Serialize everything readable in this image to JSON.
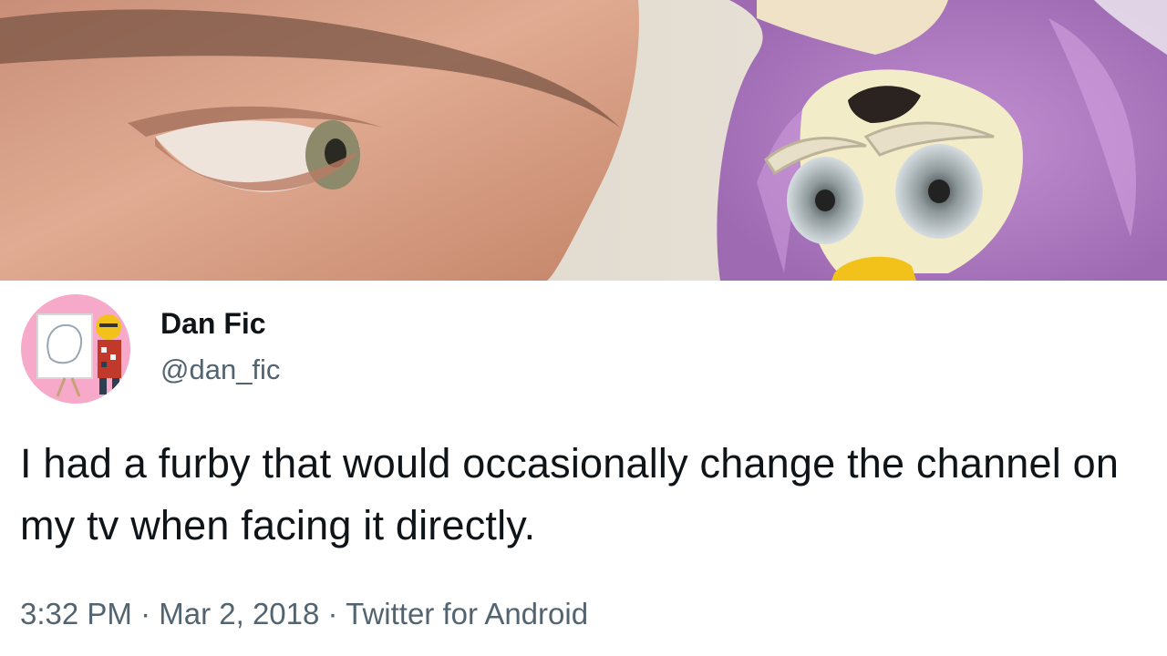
{
  "tweet": {
    "author": {
      "display_name": "Dan Fic",
      "handle": "@dan_fic"
    },
    "text": "I had a furby that would occasionally change the channel on my tv when facing it directly.",
    "meta": {
      "time": "3:32 PM",
      "separator": "·",
      "date": "Mar 2, 2018",
      "source": "Twitter for Android"
    }
  },
  "colors": {
    "text_primary": "#0f1419",
    "text_secondary": "#536471",
    "furby_fur": "#b47fc4",
    "furby_beak": "#f2c21b",
    "skin": "#d8a187",
    "avatar_bg": "#f6a9c8"
  },
  "icons": {
    "banner_photo": "face-and-furby-photo",
    "avatar": "illustrated-avatar"
  }
}
